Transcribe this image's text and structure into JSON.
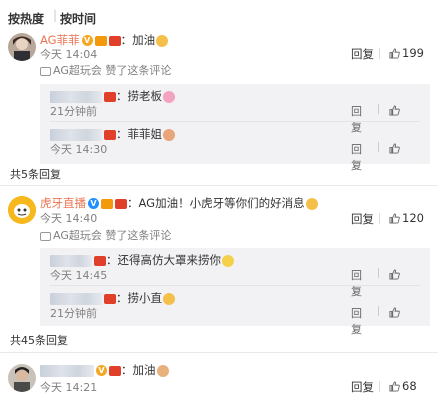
{
  "sort": {
    "hot": "按热度",
    "separator": "|",
    "time": "按时间"
  },
  "comments": [
    {
      "user": "AG菲菲",
      "text": "加油",
      "time": "今天 14:04",
      "liked_by": "AG超玩会 赞了这条评论",
      "reply_label": "回复",
      "likes": "199",
      "replies": [
        {
          "text": "捞老板",
          "time": "21分钟前",
          "reply_label": "回复"
        },
        {
          "text": "菲菲姐",
          "time": "今天 14:30",
          "reply_label": "回复"
        }
      ],
      "more": "共5条回复"
    },
    {
      "user": "虎牙直播",
      "text": "AG加油！小虎牙等你们的好消息",
      "time": "今天 14:40",
      "liked_by": "AG超玩会 赞了这条评论",
      "reply_label": "回复",
      "likes": "120",
      "replies": [
        {
          "text": "还得高仿大罩来捞你",
          "time": "今天 14:45",
          "reply_label": "回复"
        },
        {
          "text": "捞小直",
          "time": "21分钟前",
          "reply_label": "回复"
        }
      ],
      "more": "共45条回复"
    },
    {
      "user": "",
      "text": "加油",
      "time": "今天 14:21",
      "reply_label": "回复",
      "likes": "68"
    }
  ],
  "icons": [
    "thumb-up-icon",
    "like-notice-icon",
    "verified-v-icon",
    "vip-badge-icon",
    "red-badge-icon",
    "emoji-icon"
  ],
  "colors": {
    "username": "#eb7350",
    "reply_bg": "#f2f2f5",
    "meta": "#808080",
    "badge_orange": "#f5a623",
    "badge_red": "#e0402a"
  }
}
